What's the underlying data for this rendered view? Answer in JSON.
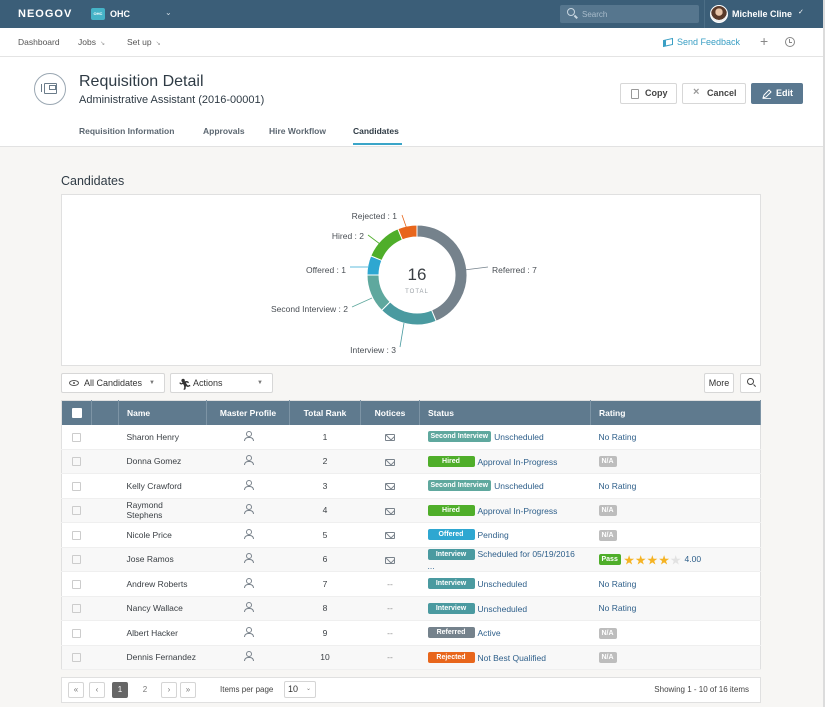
{
  "topbar": {
    "logo": "NEOGOV",
    "org_badge": "OHC",
    "org_name": "OHC",
    "search_placeholder": "Search",
    "user_name": "Michelle Cline"
  },
  "nav": {
    "items": [
      {
        "label": "Dashboard",
        "has_caret": false
      },
      {
        "label": "Jobs",
        "has_caret": true
      },
      {
        "label": "Set up",
        "has_caret": true
      }
    ],
    "feedback_label": "Send Feedback",
    "plus_label": "+"
  },
  "header": {
    "title": "Requisition Detail",
    "subtitle": "Administrative Assistant (2016-00001)",
    "buttons": {
      "copy": "Copy",
      "cancel": "Cancel",
      "edit": "Edit"
    },
    "tabs": [
      {
        "label": "Requisition Information",
        "active": false
      },
      {
        "label": "Approvals",
        "active": false
      },
      {
        "label": "Hire Workflow",
        "active": false
      },
      {
        "label": "Candidates",
        "active": true
      }
    ]
  },
  "section_title": "Candidates",
  "chart_data": {
    "type": "pie",
    "variant": "donut",
    "title": "",
    "center_value": "16",
    "center_label": "TOTAL",
    "slices": [
      {
        "label": "Referred",
        "value": 7,
        "color": "#75828c"
      },
      {
        "label": "Interview",
        "value": 3,
        "color": "#4a9aa0"
      },
      {
        "label": "Second Interview",
        "value": 2,
        "color": "#5fa89e"
      },
      {
        "label": "Offered",
        "value": 1,
        "color": "#2ea7d1"
      },
      {
        "label": "Hired",
        "value": 2,
        "color": "#4fae2a"
      },
      {
        "label": "Rejected",
        "value": 1,
        "color": "#e8661c"
      }
    ],
    "label_format": "{label} : {value}"
  },
  "toolbar": {
    "filter_label": "All Candidates",
    "actions_label": "Actions",
    "more_label": "More"
  },
  "table": {
    "columns": [
      "",
      "",
      "Name",
      "Master Profile",
      "Total Rank",
      "Notices",
      "Status",
      "Rating"
    ],
    "rows": [
      {
        "name": "Sharon Henry",
        "rank": "1",
        "notice": "mail",
        "status": "Second Interview",
        "status_color": "#5fa89e",
        "status_text": "Unscheduled",
        "rating": {
          "type": "text",
          "value": "No Rating"
        }
      },
      {
        "name": "Donna Gomez",
        "rank": "2",
        "notice": "mail",
        "status": "Hired",
        "status_color": "#4fae2a",
        "status_text": "Approval In-Progress",
        "rating": {
          "type": "na",
          "value": "N/A"
        }
      },
      {
        "name": "Kelly Crawford",
        "rank": "3",
        "notice": "mail",
        "status": "Second Interview",
        "status_color": "#5fa89e",
        "status_text": "Unscheduled",
        "rating": {
          "type": "text",
          "value": "No Rating"
        }
      },
      {
        "name": "Raymond Stephens",
        "rank": "4",
        "notice": "mail",
        "status": "Hired",
        "status_color": "#4fae2a",
        "status_text": "Approval In-Progress",
        "rating": {
          "type": "na",
          "value": "N/A"
        }
      },
      {
        "name": "Nicole Price",
        "rank": "5",
        "notice": "mail",
        "status": "Offered",
        "status_color": "#2ea7d1",
        "status_text": "Pending",
        "rating": {
          "type": "na",
          "value": "N/A"
        }
      },
      {
        "name": "Jose Ramos",
        "rank": "6",
        "notice": "mail",
        "status": "Interview",
        "status_color": "#4a9aa0",
        "status_text": "Scheduled for 05/19/2016 ...",
        "rating": {
          "type": "stars",
          "pass": "Pass",
          "stars": 4,
          "max": 5,
          "score": "4.00"
        }
      },
      {
        "name": "Andrew Roberts",
        "rank": "7",
        "notice": "--",
        "status": "Interview",
        "status_color": "#4a9aa0",
        "status_text": "Unscheduled",
        "rating": {
          "type": "text",
          "value": "No Rating"
        }
      },
      {
        "name": "Nancy Wallace",
        "rank": "8",
        "notice": "--",
        "status": "Interview",
        "status_color": "#4a9aa0",
        "status_text": "Unscheduled",
        "rating": {
          "type": "text",
          "value": "No Rating"
        }
      },
      {
        "name": "Albert Hacker",
        "rank": "9",
        "notice": "--",
        "status": "Referred",
        "status_color": "#75828c",
        "status_text": "Active",
        "rating": {
          "type": "na",
          "value": "N/A"
        }
      },
      {
        "name": "Dennis Fernandez",
        "rank": "10",
        "notice": "--",
        "status": "Rejected",
        "status_color": "#e8661c",
        "status_text": "Not Best Qualified",
        "rating": {
          "type": "na",
          "value": "N/A"
        }
      }
    ]
  },
  "pagination": {
    "first": "«",
    "prev": "‹",
    "pages": [
      "1",
      "2"
    ],
    "current_page": "1",
    "next": "›",
    "last": "»",
    "items_per_page_label": "Items per page",
    "items_per_page": "10",
    "showing": "Showing 1 - 10 of 16 items"
  },
  "colors": {
    "topbar": "#3b5e78",
    "accent": "#3aa5c8",
    "table_header": "#5f7a8e",
    "star": "#f5b323",
    "star_empty": "#e2e2e2"
  }
}
